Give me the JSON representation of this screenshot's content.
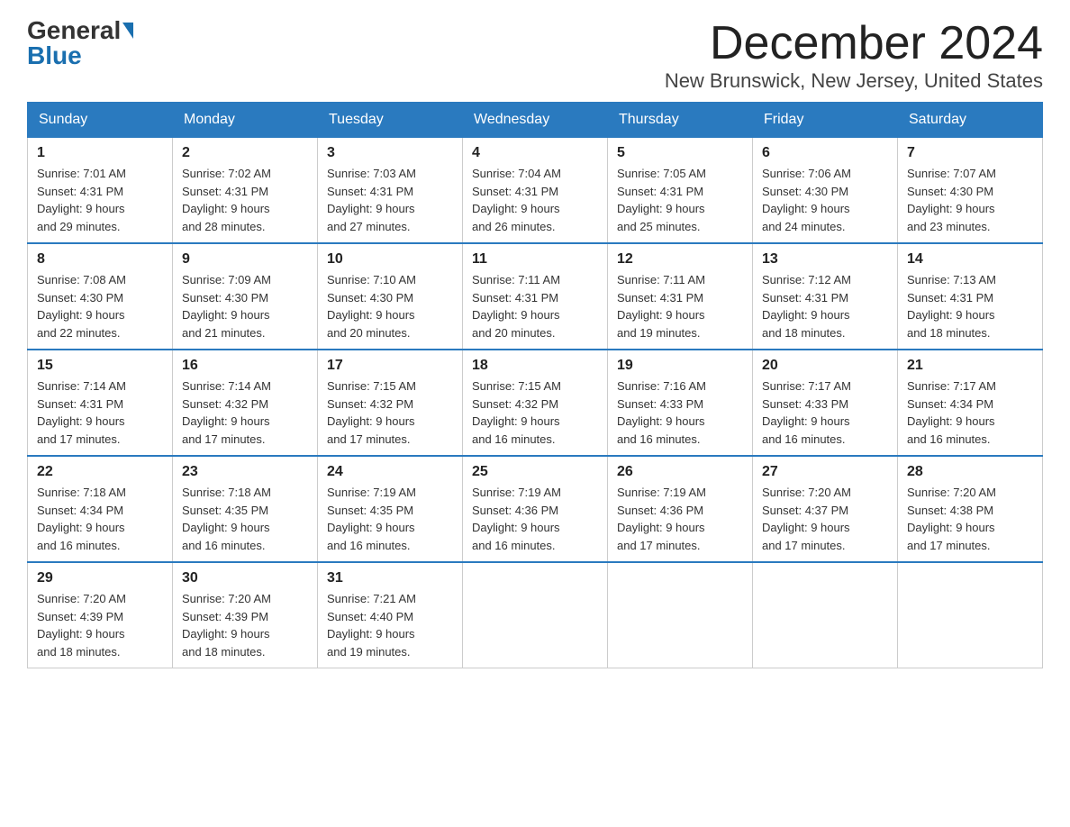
{
  "logo": {
    "general": "General",
    "blue": "Blue"
  },
  "title": "December 2024",
  "location": "New Brunswick, New Jersey, United States",
  "weekdays": [
    "Sunday",
    "Monday",
    "Tuesday",
    "Wednesday",
    "Thursday",
    "Friday",
    "Saturday"
  ],
  "weeks": [
    [
      {
        "day": "1",
        "sunrise": "7:01 AM",
        "sunset": "4:31 PM",
        "daylight": "9 hours and 29 minutes."
      },
      {
        "day": "2",
        "sunrise": "7:02 AM",
        "sunset": "4:31 PM",
        "daylight": "9 hours and 28 minutes."
      },
      {
        "day": "3",
        "sunrise": "7:03 AM",
        "sunset": "4:31 PM",
        "daylight": "9 hours and 27 minutes."
      },
      {
        "day": "4",
        "sunrise": "7:04 AM",
        "sunset": "4:31 PM",
        "daylight": "9 hours and 26 minutes."
      },
      {
        "day": "5",
        "sunrise": "7:05 AM",
        "sunset": "4:31 PM",
        "daylight": "9 hours and 25 minutes."
      },
      {
        "day": "6",
        "sunrise": "7:06 AM",
        "sunset": "4:30 PM",
        "daylight": "9 hours and 24 minutes."
      },
      {
        "day": "7",
        "sunrise": "7:07 AM",
        "sunset": "4:30 PM",
        "daylight": "9 hours and 23 minutes."
      }
    ],
    [
      {
        "day": "8",
        "sunrise": "7:08 AM",
        "sunset": "4:30 PM",
        "daylight": "9 hours and 22 minutes."
      },
      {
        "day": "9",
        "sunrise": "7:09 AM",
        "sunset": "4:30 PM",
        "daylight": "9 hours and 21 minutes."
      },
      {
        "day": "10",
        "sunrise": "7:10 AM",
        "sunset": "4:30 PM",
        "daylight": "9 hours and 20 minutes."
      },
      {
        "day": "11",
        "sunrise": "7:11 AM",
        "sunset": "4:31 PM",
        "daylight": "9 hours and 20 minutes."
      },
      {
        "day": "12",
        "sunrise": "7:11 AM",
        "sunset": "4:31 PM",
        "daylight": "9 hours and 19 minutes."
      },
      {
        "day": "13",
        "sunrise": "7:12 AM",
        "sunset": "4:31 PM",
        "daylight": "9 hours and 18 minutes."
      },
      {
        "day": "14",
        "sunrise": "7:13 AM",
        "sunset": "4:31 PM",
        "daylight": "9 hours and 18 minutes."
      }
    ],
    [
      {
        "day": "15",
        "sunrise": "7:14 AM",
        "sunset": "4:31 PM",
        "daylight": "9 hours and 17 minutes."
      },
      {
        "day": "16",
        "sunrise": "7:14 AM",
        "sunset": "4:32 PM",
        "daylight": "9 hours and 17 minutes."
      },
      {
        "day": "17",
        "sunrise": "7:15 AM",
        "sunset": "4:32 PM",
        "daylight": "9 hours and 17 minutes."
      },
      {
        "day": "18",
        "sunrise": "7:15 AM",
        "sunset": "4:32 PM",
        "daylight": "9 hours and 16 minutes."
      },
      {
        "day": "19",
        "sunrise": "7:16 AM",
        "sunset": "4:33 PM",
        "daylight": "9 hours and 16 minutes."
      },
      {
        "day": "20",
        "sunrise": "7:17 AM",
        "sunset": "4:33 PM",
        "daylight": "9 hours and 16 minutes."
      },
      {
        "day": "21",
        "sunrise": "7:17 AM",
        "sunset": "4:34 PM",
        "daylight": "9 hours and 16 minutes."
      }
    ],
    [
      {
        "day": "22",
        "sunrise": "7:18 AM",
        "sunset": "4:34 PM",
        "daylight": "9 hours and 16 minutes."
      },
      {
        "day": "23",
        "sunrise": "7:18 AM",
        "sunset": "4:35 PM",
        "daylight": "9 hours and 16 minutes."
      },
      {
        "day": "24",
        "sunrise": "7:19 AM",
        "sunset": "4:35 PM",
        "daylight": "9 hours and 16 minutes."
      },
      {
        "day": "25",
        "sunrise": "7:19 AM",
        "sunset": "4:36 PM",
        "daylight": "9 hours and 16 minutes."
      },
      {
        "day": "26",
        "sunrise": "7:19 AM",
        "sunset": "4:36 PM",
        "daylight": "9 hours and 17 minutes."
      },
      {
        "day": "27",
        "sunrise": "7:20 AM",
        "sunset": "4:37 PM",
        "daylight": "9 hours and 17 minutes."
      },
      {
        "day": "28",
        "sunrise": "7:20 AM",
        "sunset": "4:38 PM",
        "daylight": "9 hours and 17 minutes."
      }
    ],
    [
      {
        "day": "29",
        "sunrise": "7:20 AM",
        "sunset": "4:39 PM",
        "daylight": "9 hours and 18 minutes."
      },
      {
        "day": "30",
        "sunrise": "7:20 AM",
        "sunset": "4:39 PM",
        "daylight": "9 hours and 18 minutes."
      },
      {
        "day": "31",
        "sunrise": "7:21 AM",
        "sunset": "4:40 PM",
        "daylight": "9 hours and 19 minutes."
      },
      null,
      null,
      null,
      null
    ]
  ],
  "labels": {
    "sunrise": "Sunrise: ",
    "sunset": "Sunset: ",
    "daylight": "Daylight: "
  }
}
